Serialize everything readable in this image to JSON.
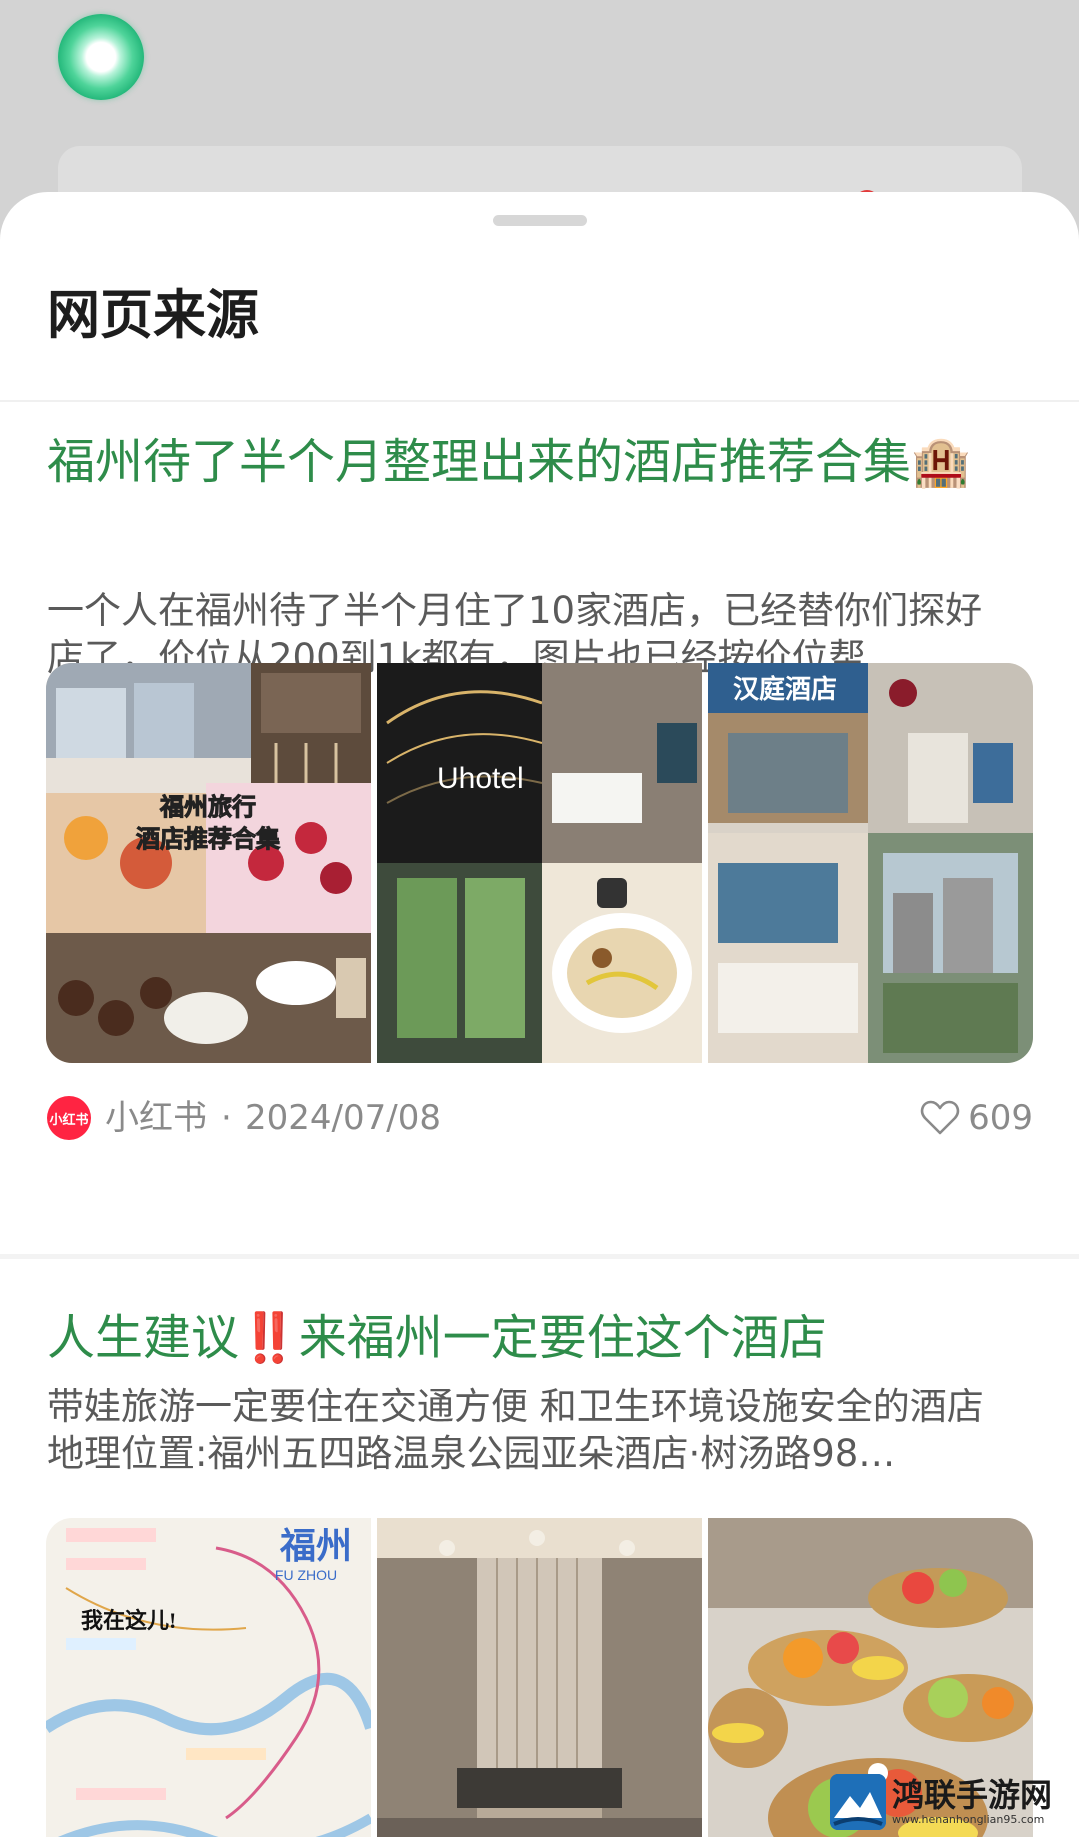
{
  "sheet": {
    "title": "网页来源"
  },
  "results": [
    {
      "title": "福州待了半个月整理出来的酒店推荐合集🏨",
      "summary": "一个人在福州待了半个月住了10家酒店，已经替你们探好店了，价位从200到1k都有，图片也已经按价位帮…",
      "thumbnails": [
        {
          "overlay_text": "福州旅行\n酒店推荐合集"
        },
        {
          "overlay_text": "Uhotel"
        },
        {
          "overlay_text": "汉庭酒店"
        }
      ],
      "source": {
        "logo_text": "小红书",
        "name": "小红书",
        "separator": "·",
        "date": "2024/07/08"
      },
      "likes": "609"
    },
    {
      "title": "人生建议‼️来福州一定要住这个酒店",
      "summary": "带娃旅游一定要住在交通方便 和卫生环境设施安全的酒店 地理位置:福州五四路温泉公园亚朵酒店·树汤路98…",
      "thumbnails": [
        {
          "overlay_text": "福州",
          "overlay_sub": "FU ZHOU",
          "map_label": "我在这儿!"
        },
        {
          "overlay_text": ""
        },
        {
          "overlay_text": ""
        }
      ]
    }
  ],
  "watermark": {
    "main": "鸿联手游网",
    "sub": "www.henanhonglian95.com"
  },
  "colors": {
    "title_green": "#2e8c4a",
    "xhs_red": "#ff2442",
    "orb_green": "#26b97c"
  },
  "icons": [
    "assistant-orb",
    "heart-icon",
    "xiaohongshu-logo"
  ]
}
